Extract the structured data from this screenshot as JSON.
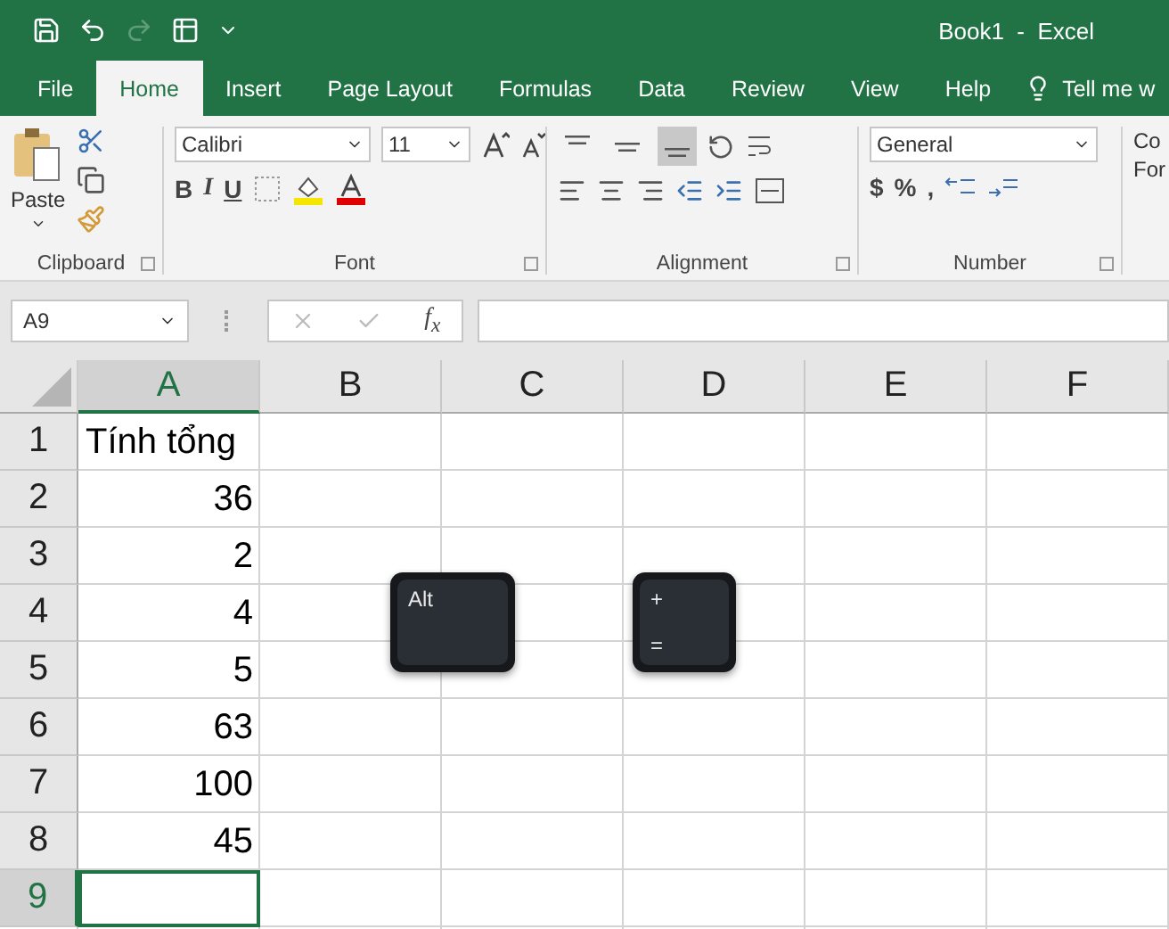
{
  "window": {
    "title": "Book1  -  Excel"
  },
  "quick_access": [
    {
      "kind": "save",
      "disabled": false
    },
    {
      "kind": "undo",
      "disabled": false
    },
    {
      "kind": "redo",
      "disabled": true
    },
    {
      "kind": "form",
      "disabled": false
    },
    {
      "kind": "customize",
      "disabled": false
    }
  ],
  "tabs": [
    {
      "label": "File",
      "selected": false
    },
    {
      "label": "Home",
      "selected": true
    },
    {
      "label": "Insert",
      "selected": false
    },
    {
      "label": "Page Layout",
      "selected": false
    },
    {
      "label": "Formulas",
      "selected": false
    },
    {
      "label": "Data",
      "selected": false
    },
    {
      "label": "Review",
      "selected": false
    },
    {
      "label": "View",
      "selected": false
    },
    {
      "label": "Help",
      "selected": false
    }
  ],
  "tell_me": "Tell me w",
  "ribbon": {
    "clipboard": {
      "paste": "Paste",
      "label": "Clipboard"
    },
    "font": {
      "font_name": "Calibri",
      "font_size": "11",
      "bold": "B",
      "italic": "I",
      "underline": "U",
      "label": "Font"
    },
    "alignment": {
      "vertical": [
        {
          "kind": "top",
          "selected": false
        },
        {
          "kind": "middle",
          "selected": false
        },
        {
          "kind": "bottom",
          "selected": true
        }
      ],
      "label": "Alignment"
    },
    "number": {
      "format": "General",
      "currency": "$",
      "percent": "%",
      "comma": ",",
      "label": "Number"
    },
    "styles": {
      "line_1": "Co",
      "line_2": "For"
    }
  },
  "formula_bar": {
    "name_box": "A9",
    "fx": "f$_{x}$"
  },
  "sheet": {
    "columns": [
      {
        "label": "A",
        "selected": true
      },
      {
        "label": "B",
        "selected": false
      },
      {
        "label": "C",
        "selected": false
      },
      {
        "label": "D",
        "selected": false
      },
      {
        "label": "E",
        "selected": false
      },
      {
        "label": "F",
        "selected": false
      }
    ],
    "rows": [
      {
        "header": "1",
        "selected": false,
        "value": "Tính tổng",
        "kind": "text"
      },
      {
        "header": "2",
        "selected": false,
        "value": "36",
        "kind": "number"
      },
      {
        "header": "3",
        "selected": false,
        "value": "2",
        "kind": "number"
      },
      {
        "header": "4",
        "selected": false,
        "value": "4",
        "kind": "number"
      },
      {
        "header": "5",
        "selected": false,
        "value": "5",
        "kind": "number"
      },
      {
        "header": "6",
        "selected": false,
        "value": "63",
        "kind": "number"
      },
      {
        "header": "7",
        "selected": false,
        "value": "100",
        "kind": "number"
      },
      {
        "header": "8",
        "selected": false,
        "value": "45",
        "kind": "number"
      },
      {
        "header": "9",
        "selected": true,
        "value": "",
        "kind": "text"
      }
    ]
  },
  "keys": [
    {
      "labels": [
        "Alt"
      ]
    },
    {
      "labels": [
        "+",
        "="
      ]
    }
  ]
}
